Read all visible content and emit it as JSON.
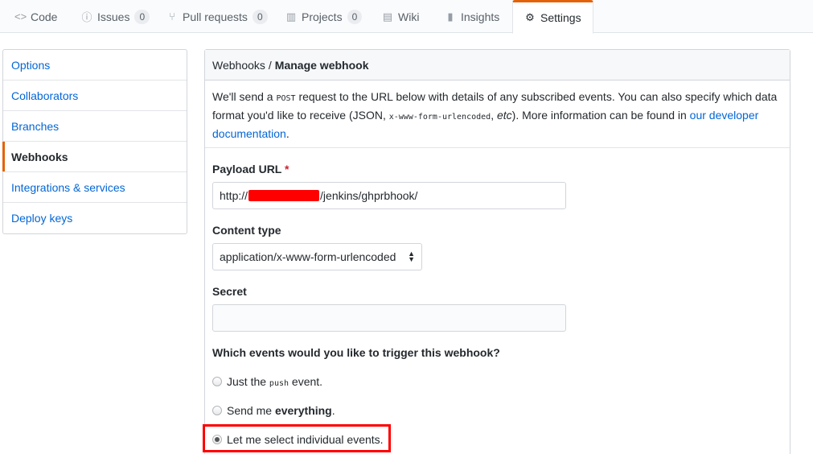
{
  "nav": {
    "tabs": [
      {
        "label": "Code",
        "icon": "code-icon",
        "glyph": "<>",
        "counter": null
      },
      {
        "label": "Issues",
        "icon": "issue-icon",
        "glyph": "ⓘ",
        "counter": "0"
      },
      {
        "label": "Pull requests",
        "icon": "pull-request-icon",
        "glyph": "⑂",
        "counter": "0"
      },
      {
        "label": "Projects",
        "icon": "project-icon",
        "glyph": "▥",
        "counter": "0"
      },
      {
        "label": "Wiki",
        "icon": "book-icon",
        "glyph": "▤",
        "counter": null
      },
      {
        "label": "Insights",
        "icon": "graph-icon",
        "glyph": "▮",
        "counter": null
      },
      {
        "label": "Settings",
        "icon": "gear-icon",
        "glyph": "⚙",
        "counter": null
      }
    ]
  },
  "sidebar": {
    "items": [
      {
        "label": "Options"
      },
      {
        "label": "Collaborators"
      },
      {
        "label": "Branches"
      },
      {
        "label": "Webhooks"
      },
      {
        "label": "Integrations & services"
      },
      {
        "label": "Deploy keys"
      }
    ]
  },
  "header": {
    "crumb": "Webhooks",
    "separator": "/",
    "current": "Manage webhook"
  },
  "intro": {
    "t1": "We'll send a ",
    "post": "POST",
    "t2": " request to the URL below with details of any subscribed events. You can also specify which data format you'd like to receive (JSON, ",
    "code": "x-www-form-urlencoded",
    "t3": ", ",
    "etc": "etc",
    "t4": "). More information can be found in ",
    "link": "our developer documentation",
    "t5": "."
  },
  "form": {
    "payload_label": "Payload URL",
    "required_mark": "*",
    "payload_prefix": "http://",
    "payload_suffix": "/jenkins/ghprbhook/",
    "content_type_label": "Content type",
    "content_type_value": "application/x-www-form-urlencoded",
    "secret_label": "Secret",
    "secret_value": "",
    "events_question": "Which events would you like to trigger this webhook?",
    "opt1_a": "Just the ",
    "opt1_code": "push",
    "opt1_b": " event.",
    "opt2_a": "Send me ",
    "opt2_b": "everything",
    "opt2_c": ".",
    "opt3": "Let me select individual events.",
    "selected_option": "Let me select individual events."
  },
  "colors": {
    "accent": "#e36209",
    "link": "#0366d6",
    "highlight": "#ff0000"
  }
}
